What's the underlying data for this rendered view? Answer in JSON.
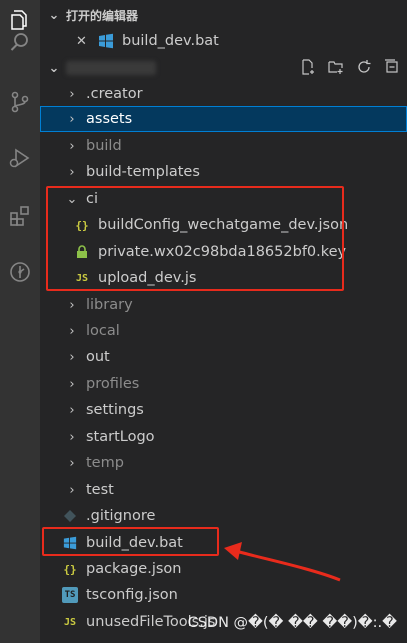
{
  "open_editors": {
    "header": "打开的编辑器",
    "items": [
      {
        "name": "build_dev.bat",
        "icon": "windows-icon"
      }
    ]
  },
  "explorer": {
    "tree": [
      {
        "label": ".creator",
        "type": "folder",
        "dim": false
      },
      {
        "label": "assets",
        "type": "folder",
        "dim": false,
        "selected": true
      },
      {
        "label": "build",
        "type": "folder",
        "dim": true
      },
      {
        "label": "build-templates",
        "type": "folder",
        "dim": false
      },
      {
        "label": "ci",
        "type": "folder-open",
        "dim": false
      },
      {
        "label": "buildConfig_wechatgame_dev.json",
        "type": "json",
        "dim": false,
        "indent": 1
      },
      {
        "label": "private.wx02c98bda18652bf0.key",
        "type": "lock",
        "dim": false,
        "indent": 1
      },
      {
        "label": "upload_dev.js",
        "type": "js",
        "dim": false,
        "indent": 1
      },
      {
        "label": "library",
        "type": "folder",
        "dim": true
      },
      {
        "label": "local",
        "type": "folder",
        "dim": true
      },
      {
        "label": "out",
        "type": "folder",
        "dim": false
      },
      {
        "label": "profiles",
        "type": "folder",
        "dim": true
      },
      {
        "label": "settings",
        "type": "folder",
        "dim": false
      },
      {
        "label": "startLogo",
        "type": "folder",
        "dim": false
      },
      {
        "label": "temp",
        "type": "folder",
        "dim": true
      },
      {
        "label": "test",
        "type": "folder",
        "dim": false
      },
      {
        "label": ".gitignore",
        "type": "git",
        "dim": false
      },
      {
        "label": "build_dev.bat",
        "type": "bat",
        "dim": false
      },
      {
        "label": "package.json",
        "type": "json",
        "dim": false
      },
      {
        "label": "tsconfig.json",
        "type": "ts",
        "dim": false
      },
      {
        "label": "unusedFileTools.js",
        "type": "js",
        "dim": false
      }
    ]
  },
  "icons": {
    "json": "{}",
    "js": "JS",
    "ts": "TS",
    "close": "✕",
    "chev_right": "›",
    "chev_down": "⌄"
  },
  "colors": {
    "accent": "#007fd4",
    "highlight": "#e82b1c",
    "selected_bg": "#04395e"
  },
  "watermark": "CSDN @�(� �� ��)�:.�"
}
